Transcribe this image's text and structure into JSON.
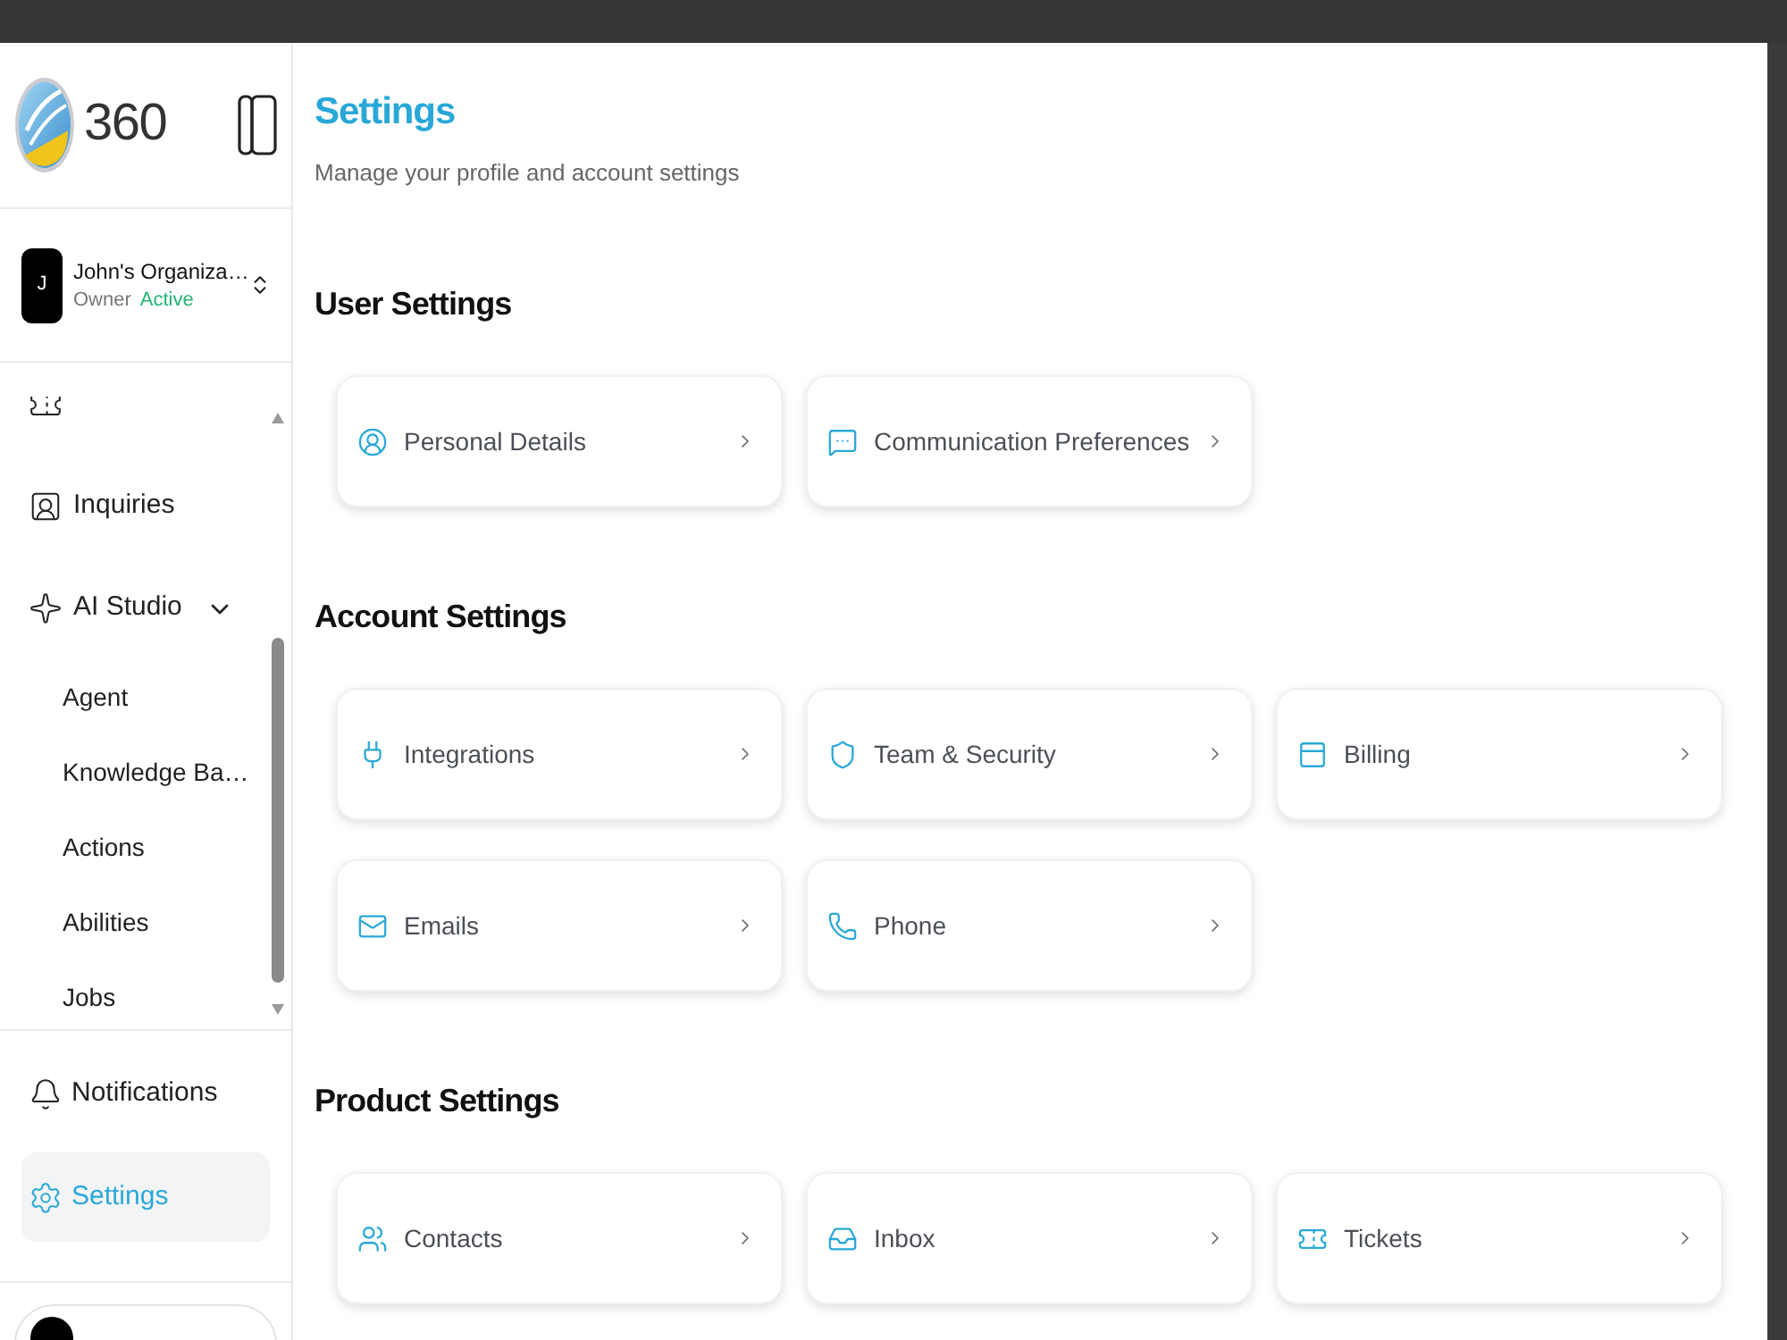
{
  "sidebar": {
    "logo": {
      "text": "360"
    },
    "organization": {
      "initial": "J",
      "name": "John's Organiza…",
      "role": "Owner",
      "status": "Active"
    },
    "nav_items": [
      {
        "label": "Inquiries",
        "selected": false
      },
      {
        "label": "AI Studio",
        "selected": false,
        "expanded": true,
        "children": [
          {
            "label": "Agent",
            "selected": false
          },
          {
            "label": "Knowledge Ba…",
            "selected": false
          },
          {
            "label": "Actions",
            "selected": false
          },
          {
            "label": "Abilities",
            "selected": false
          },
          {
            "label": "Jobs",
            "selected": false
          }
        ]
      }
    ],
    "bottom_items": [
      {
        "label": "Notifications",
        "selected": false
      },
      {
        "label": "Settings",
        "selected": true
      }
    ]
  },
  "page": {
    "title": "Settings",
    "subtitle": "Manage your profile and account settings"
  },
  "sections": [
    {
      "title": "User Settings",
      "cards": [
        {
          "label": "Personal Details"
        },
        {
          "label": "Communication Preferences"
        }
      ]
    },
    {
      "title": "Account Settings",
      "cards": [
        {
          "label": "Integrations"
        },
        {
          "label": "Team & Security"
        },
        {
          "label": "Billing"
        },
        {
          "label": "Emails"
        },
        {
          "label": "Phone"
        }
      ]
    },
    {
      "title": "Product Settings",
      "cards": [
        {
          "label": "Contacts"
        },
        {
          "label": "Inbox"
        },
        {
          "label": "Tickets"
        }
      ]
    }
  ]
}
